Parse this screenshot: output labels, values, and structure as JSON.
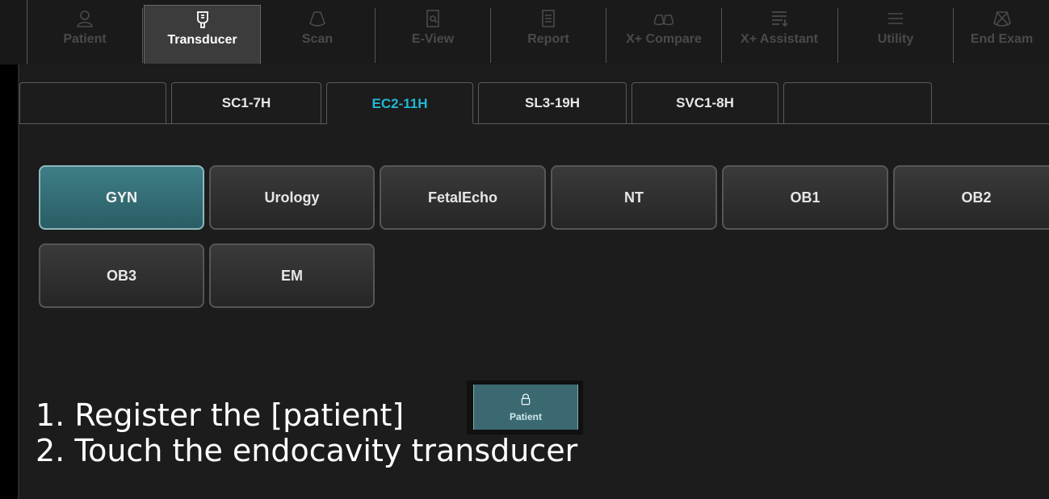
{
  "toolbar": {
    "items": [
      {
        "label": "Patient",
        "icon": "person-icon"
      },
      {
        "label": "Transducer",
        "icon": "transducer-icon"
      },
      {
        "label": "Scan",
        "icon": "scan-icon"
      },
      {
        "label": "E-View",
        "icon": "eview-icon"
      },
      {
        "label": "Report",
        "icon": "report-icon"
      },
      {
        "label": "X+ Compare",
        "icon": "compare-icon"
      },
      {
        "label": "X+ Assistant",
        "icon": "assistant-icon"
      },
      {
        "label": "Utility",
        "icon": "menu-icon"
      },
      {
        "label": "End Exam",
        "icon": "end-exam-icon"
      }
    ],
    "active": "Transducer"
  },
  "tabs": {
    "items": [
      "",
      "SC1-7H",
      "EC2-11H",
      "SL3-19H",
      "SVC1-8H",
      ""
    ],
    "active": "EC2-11H",
    "active_color": "#23b7d3"
  },
  "presets": {
    "row1": [
      "GYN",
      "Urology",
      "FetalEcho",
      "NT",
      "OB1",
      "OB2"
    ],
    "row2": [
      "OB3",
      "EM"
    ],
    "selected": "GYN",
    "selected_color": "#3f7e86"
  },
  "instructions": {
    "line1": "1. Register the [patient]",
    "line2": "2. Touch the endocavity transducer",
    "mini_button_label": "Patient",
    "mini_button_icon": "lock-icon"
  }
}
